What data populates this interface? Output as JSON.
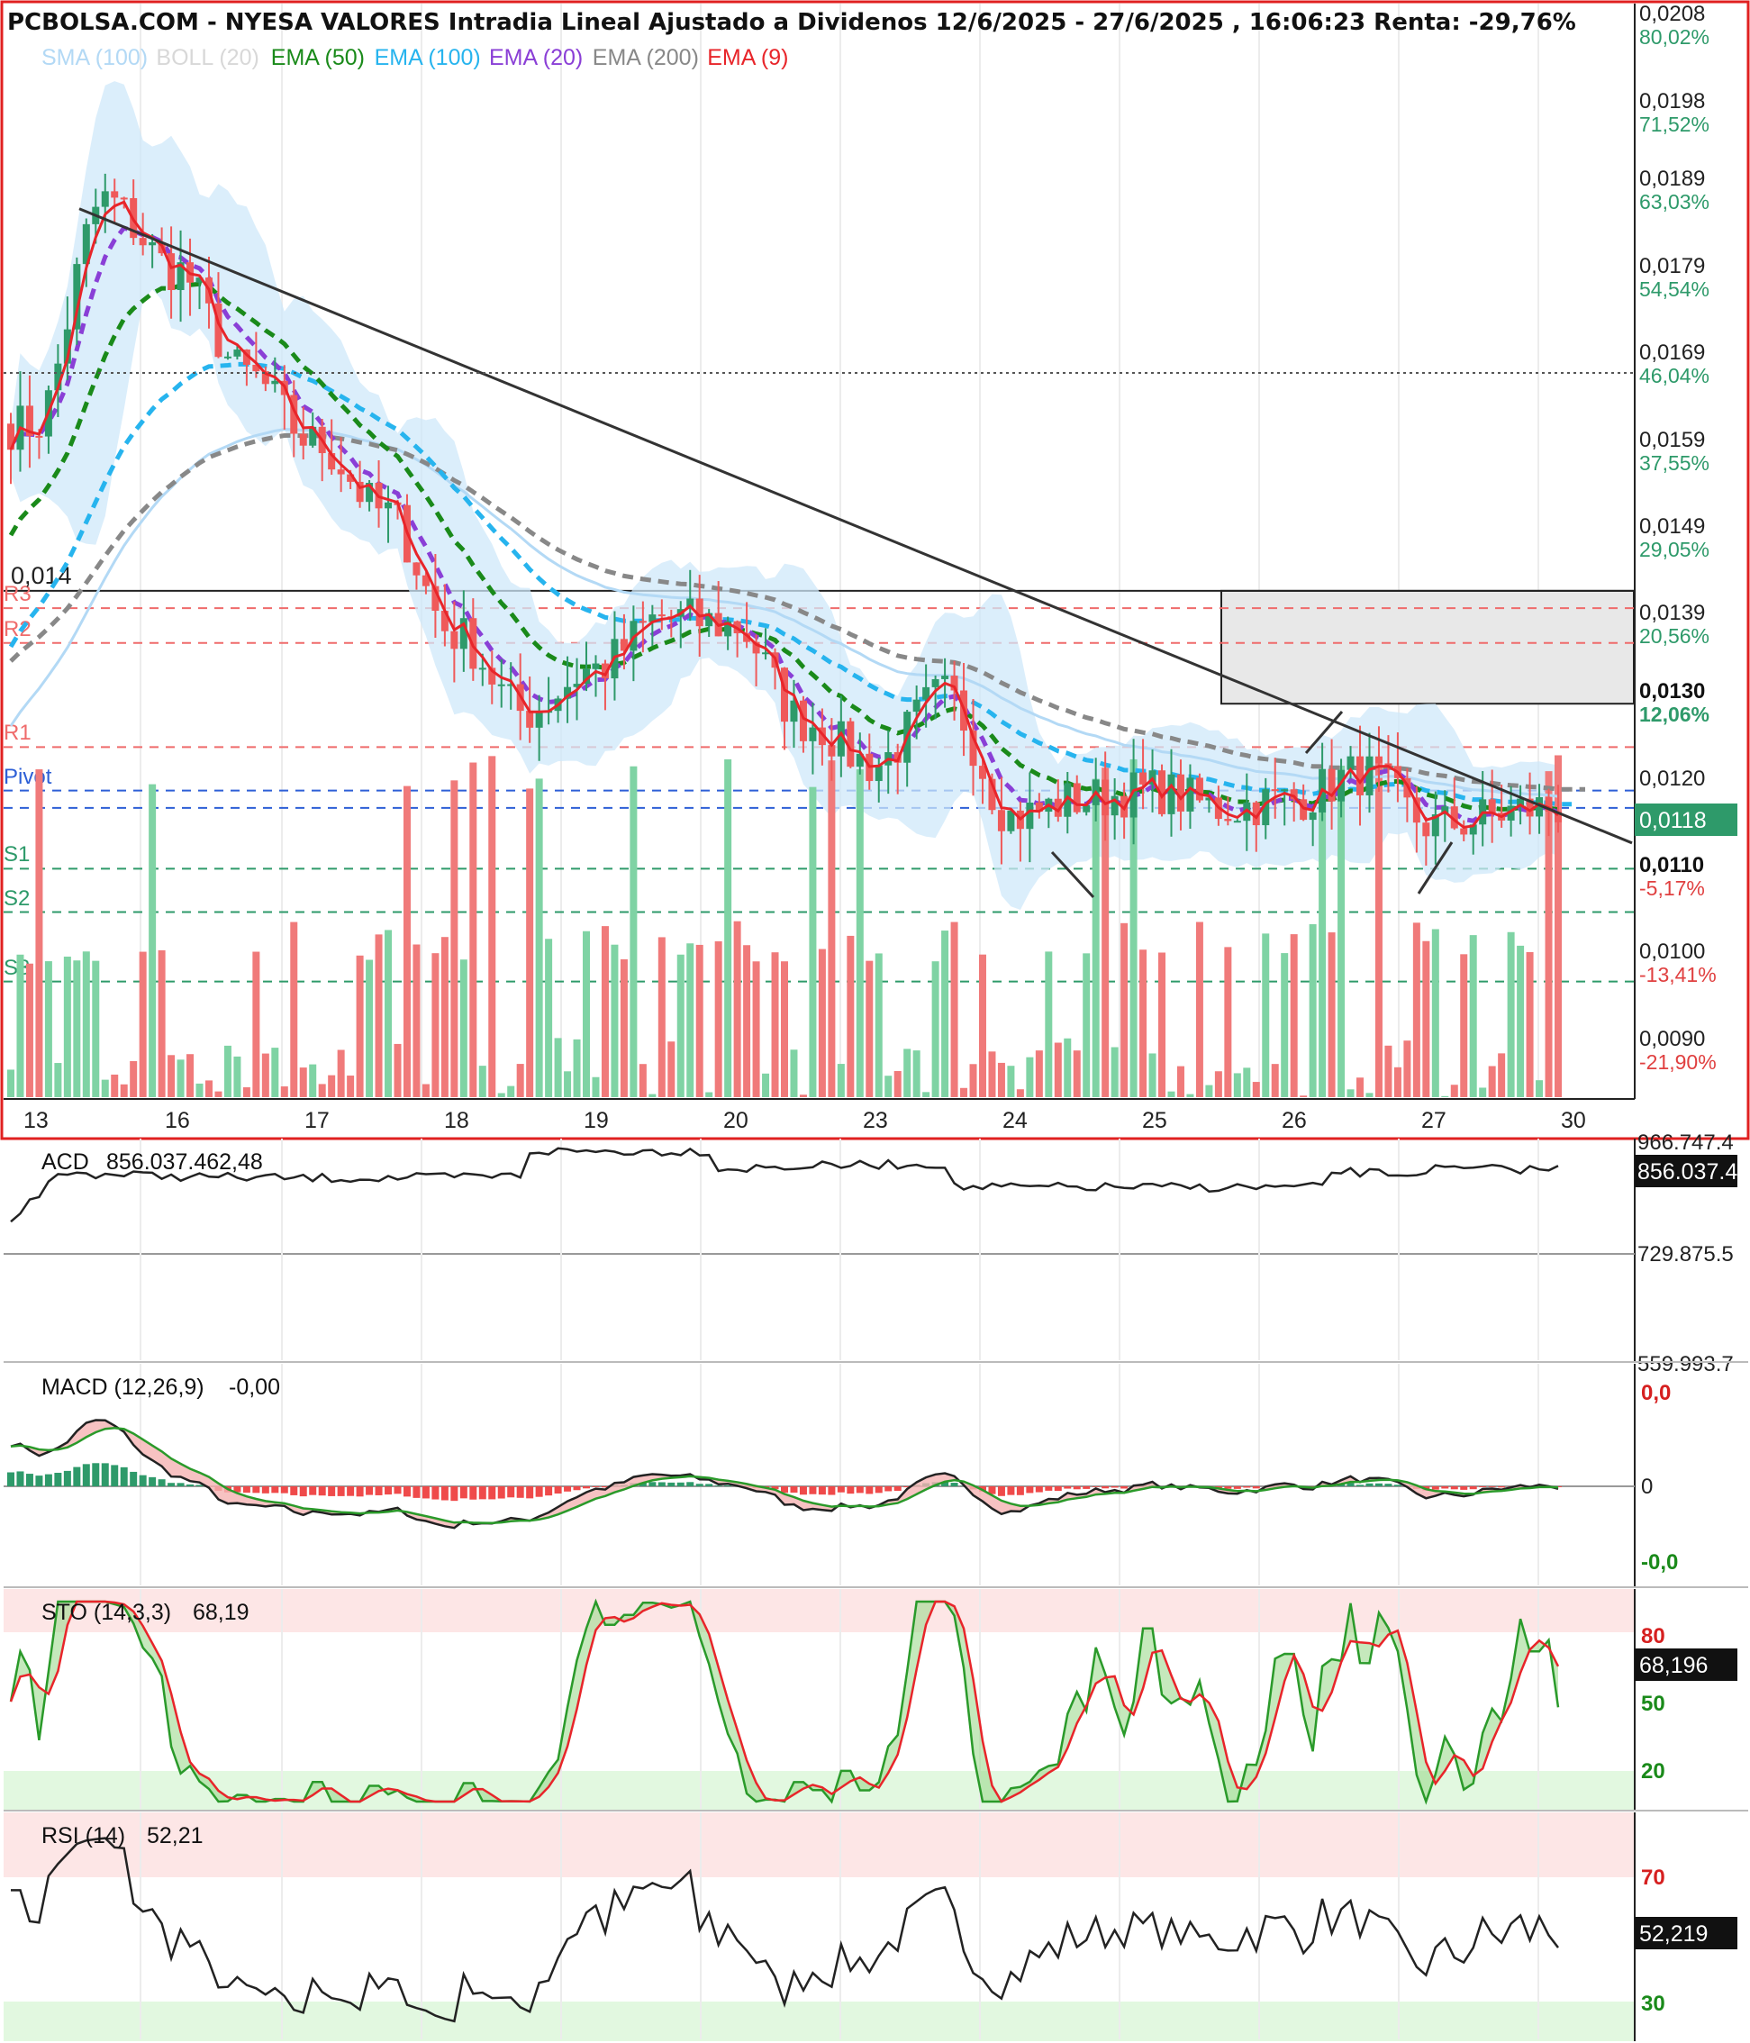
{
  "header": {
    "title": "PCBOLSA.COM - NYESA VALORES Intradia Lineal Ajustado a Dividenos 12/6/2025 - 27/6/2025 , 16:06:23 Renta: -29,76%"
  },
  "legend": [
    {
      "label": "SMA (100)",
      "color": "#b3d9f5"
    },
    {
      "label": "BOLL (20)",
      "color": "#d8d8d8"
    },
    {
      "label": "EMA (50)",
      "color": "#1a8a1a"
    },
    {
      "label": "EMA (100)",
      "color": "#27b4ee"
    },
    {
      "label": "EMA (20)",
      "color": "#8a3fd6"
    },
    {
      "label": "EMA (200)",
      "color": "#888888"
    },
    {
      "label": "EMA (9)",
      "color": "#e8252a"
    }
  ],
  "colors": {
    "up": "#2e9a6a",
    "down": "#ef5a5a",
    "vol_up": "#7fd3a4",
    "vol_down": "#f07a7a",
    "frame": "#e02020",
    "resistance": "#ef6b6b",
    "support": "#2e9a6a",
    "pivot": "#2d5fd6"
  },
  "price_axis": [
    {
      "price": "0,0208",
      "pct": "80,02%"
    },
    {
      "price": "0,0198",
      "pct": "71,52%"
    },
    {
      "price": "0,0189",
      "pct": "63,03%"
    },
    {
      "price": "0,0179",
      "pct": "54,54%"
    },
    {
      "price": "0,0169",
      "pct": "46,04%"
    },
    {
      "price": "0,0159",
      "pct": "37,55%"
    },
    {
      "price": "0,0149",
      "pct": "29,05%"
    },
    {
      "price": "0,0139",
      "pct": "20,56%"
    },
    {
      "price": "0,0130",
      "pct": "12,06%"
    },
    {
      "price": "0,0120",
      "pct": ""
    },
    {
      "price": "0,0110",
      "pct": "-5,17%"
    },
    {
      "price": "0,0100",
      "pct": "-13,41%"
    },
    {
      "price": "0,0090",
      "pct": "-21,90%"
    }
  ],
  "current_price": "0,0118",
  "x_axis": [
    "13",
    "16",
    "17",
    "18",
    "19",
    "20",
    "23",
    "24",
    "25",
    "26",
    "27",
    "30"
  ],
  "levels": {
    "zone_label": "0,014",
    "r3": "R3",
    "r2": "R2",
    "r1": "R1",
    "pivot": "Pivot",
    "s1": "S1",
    "s2": "S2",
    "s3": "S3"
  },
  "acd": {
    "title": "ACD",
    "value": "856.037.462,48",
    "badge": "856.037.4",
    "axis": [
      "966.747.4",
      "729.875.5",
      "559.993.7"
    ]
  },
  "macd": {
    "title": "MACD (12,26,9)",
    "value": "-0,00",
    "axis_top": "0,0",
    "axis_mid": "0",
    "axis_bot": "-0,0"
  },
  "sto": {
    "title": "STO (14,3,3)",
    "value": "68,19",
    "badge": "68,196",
    "axis": [
      "80",
      "50",
      "20"
    ]
  },
  "rsi": {
    "title": "RSI (14)",
    "value": "52,21",
    "badge": "52,219",
    "axis": [
      "70",
      "30"
    ]
  },
  "chart_data": {
    "type": "candlestick",
    "title": "PCBOLSA.COM - NYESA VALORES Intradia Lineal Ajustado a Dividenos 12/6/2025 - 27/6/2025 , 16:06:23 Renta: -29,76%",
    "x_categories": [
      "13",
      "16",
      "17",
      "18",
      "19",
      "20",
      "23",
      "24",
      "25",
      "26",
      "27",
      "30"
    ],
    "ylim": [
      0.0085,
      0.021
    ],
    "close_path": [
      {
        "day": 13,
        "frac": 0.0,
        "value": 0.0162
      },
      {
        "day": 13,
        "frac": 0.5,
        "value": 0.0188
      },
      {
        "day": 16,
        "frac": 0.0,
        "value": 0.018
      },
      {
        "day": 16,
        "frac": 0.5,
        "value": 0.0168
      },
      {
        "day": 17,
        "frac": 0.0,
        "value": 0.016
      },
      {
        "day": 17,
        "frac": 0.5,
        "value": 0.0152
      },
      {
        "day": 18,
        "frac": 0.0,
        "value": 0.0138
      },
      {
        "day": 18,
        "frac": 0.5,
        "value": 0.0129
      },
      {
        "day": 19,
        "frac": 0.0,
        "value": 0.0134
      },
      {
        "day": 19,
        "frac": 0.5,
        "value": 0.014
      },
      {
        "day": 20,
        "frac": 0.0,
        "value": 0.0139
      },
      {
        "day": 20,
        "frac": 0.5,
        "value": 0.0128
      },
      {
        "day": 23,
        "frac": 0.0,
        "value": 0.0123
      },
      {
        "day": 23,
        "frac": 0.5,
        "value": 0.0131
      },
      {
        "day": 24,
        "frac": 0.0,
        "value": 0.0117
      },
      {
        "day": 24,
        "frac": 0.5,
        "value": 0.0119
      },
      {
        "day": 25,
        "frac": 0.0,
        "value": 0.012
      },
      {
        "day": 25,
        "frac": 0.5,
        "value": 0.0118
      },
      {
        "day": 26,
        "frac": 0.0,
        "value": 0.0119
      },
      {
        "day": 26,
        "frac": 0.5,
        "value": 0.0122
      },
      {
        "day": 27,
        "frac": 0.0,
        "value": 0.0116
      },
      {
        "day": 27,
        "frac": 0.8,
        "value": 0.0118
      }
    ],
    "horizontal_levels": [
      {
        "name": "R3",
        "value": 0.0141
      },
      {
        "name": "R2",
        "value": 0.0137
      },
      {
        "name": "R1",
        "value": 0.0125
      },
      {
        "name": "Pivot",
        "value": 0.012
      },
      {
        "name": "Pivot-2",
        "value": 0.0118
      },
      {
        "name": "S1",
        "value": 0.0111
      },
      {
        "name": "S2",
        "value": 0.0106
      },
      {
        "name": "S3",
        "value": 0.0098
      }
    ],
    "box_zone": {
      "from": 0.013,
      "to": 0.0143
    },
    "trendline": {
      "from": 0.0187,
      "to": 0.0115
    },
    "series": [
      {
        "name": "SMA (100)"
      },
      {
        "name": "BOLL (20)"
      },
      {
        "name": "EMA (50)"
      },
      {
        "name": "EMA (100)"
      },
      {
        "name": "EMA (20)"
      },
      {
        "name": "EMA (200)"
      },
      {
        "name": "EMA (9)"
      }
    ],
    "indicators": {
      "acd": 856037462.48,
      "macd": -0.0,
      "sto": 68.19,
      "rsi": 52.21
    }
  }
}
